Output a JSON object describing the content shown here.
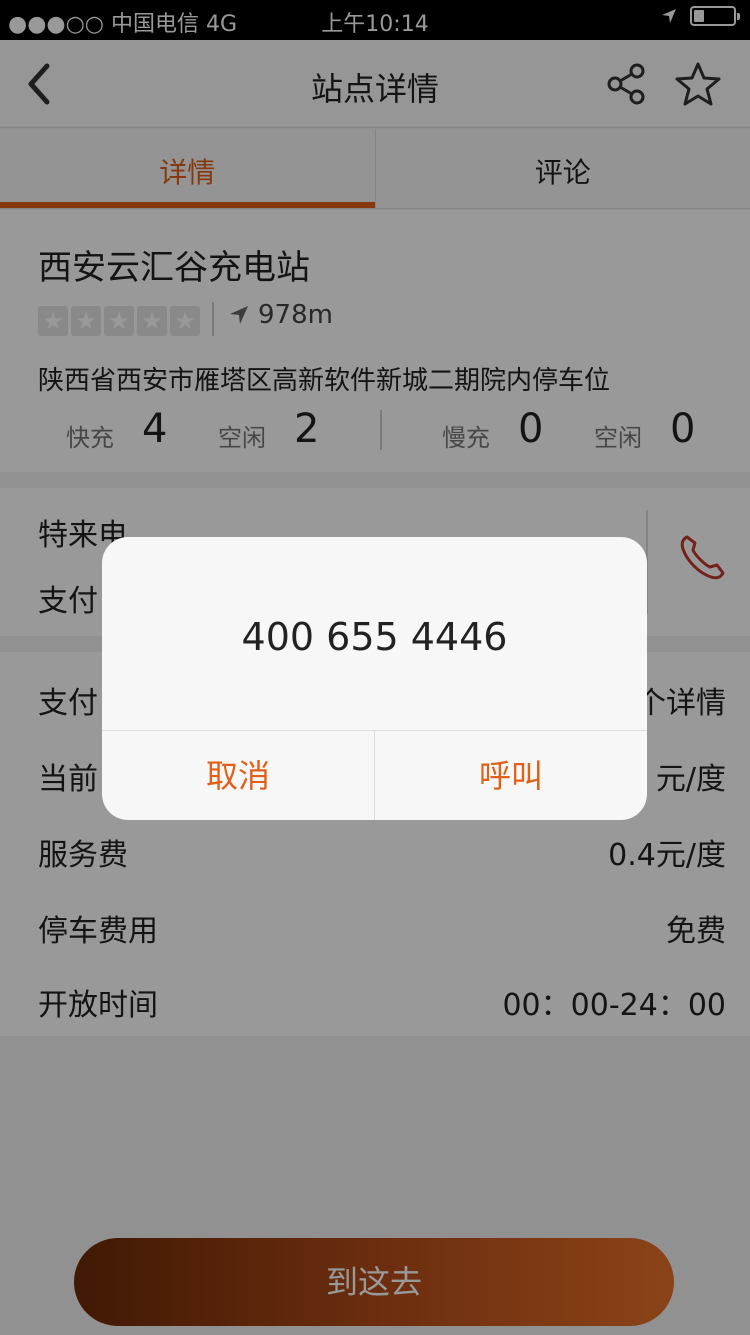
{
  "status_bar": {
    "carrier": "●●●○○ 中国电信   4G",
    "time": "上午10:14"
  },
  "nav": {
    "title": "站点详情",
    "icons": [
      "back-chevron",
      "share",
      "star"
    ]
  },
  "tabs": [
    {
      "label": "详情",
      "active": true
    },
    {
      "label": "评论",
      "active": false
    }
  ],
  "station": {
    "name": "西安云汇谷充电站",
    "rating_stars": 0,
    "distance": "978m",
    "address": "陕西省西安市雁塔区高新软件新城二期院内停车位",
    "fast_label": "快充",
    "fast_count": "4",
    "fast_idle_label": "空闲",
    "fast_idle": "2",
    "slow_label": "慢充",
    "slow_count": "0",
    "slow_idle_label": "空闲",
    "slow_idle": "0"
  },
  "contact": {
    "line1": "特来电",
    "line2": "支付"
  },
  "fees": {
    "rows": [
      {
        "key": "支付",
        "value": "个详情"
      },
      {
        "key": "当前",
        "value": "元/度"
      },
      {
        "key": "服务费",
        "value": "0.4元/度"
      },
      {
        "key": "停车费用",
        "value": "免费"
      },
      {
        "key": "开放时间",
        "value": "00：00-24：00"
      }
    ]
  },
  "go_button": "到这去",
  "dialog": {
    "number": "400 655 4446",
    "cancel": "取消",
    "call": "呼叫"
  },
  "colors": {
    "accent": "#e0601a",
    "phone_icon": "#c0392b"
  }
}
